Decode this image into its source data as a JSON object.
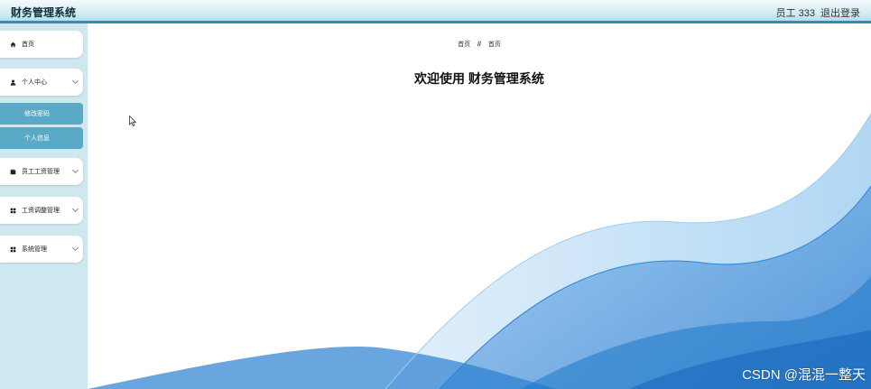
{
  "header": {
    "app_title": "财务管理系统",
    "user_label": "员工 333",
    "logout_label": "退出登录"
  },
  "sidebar": {
    "items": [
      {
        "label": "首页",
        "icon": "home-icon"
      },
      {
        "label": "个人中心",
        "icon": "user-icon",
        "expanded": true,
        "children": [
          "修改密码",
          "个人信息"
        ]
      },
      {
        "label": "员工工资管理",
        "icon": "wallet-icon"
      },
      {
        "label": "工资调整管理",
        "icon": "grid-icon"
      },
      {
        "label": "系统管理",
        "icon": "grid-icon"
      }
    ]
  },
  "main": {
    "breadcrumb": [
      "首页",
      "//",
      "首页"
    ],
    "welcome": "欢迎使用 财务管理系统"
  },
  "watermark": "CSDN @混混一整天",
  "colors": {
    "topbar_border": "#2d8fbc",
    "sidebar_bg": "#cfe7ef",
    "submenu_bg": "#5aa9c6",
    "wave_blue": "#1e78c8"
  }
}
